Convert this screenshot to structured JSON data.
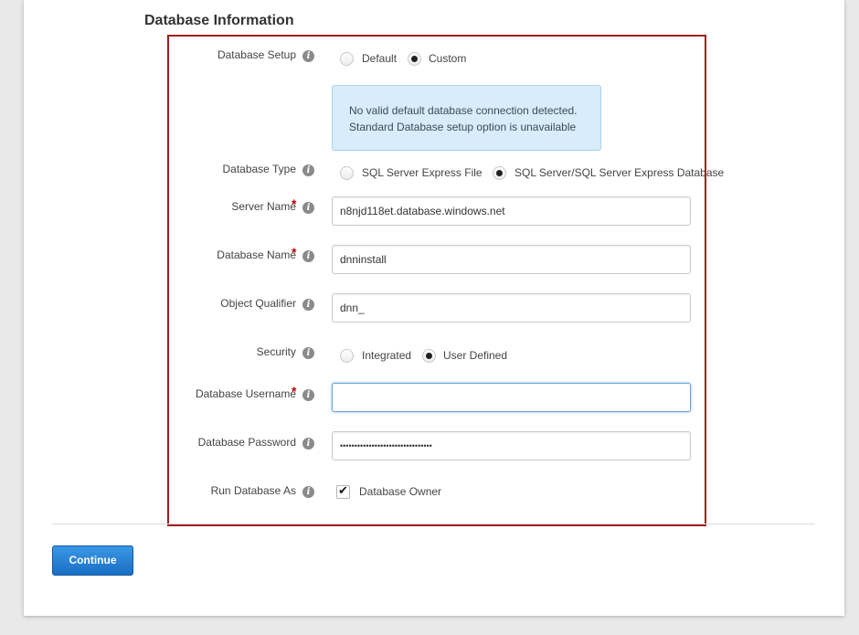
{
  "section": {
    "title": "Database Information"
  },
  "database_setup": {
    "label": "Database Setup",
    "options": [
      {
        "label": "Default",
        "checked": false
      },
      {
        "label": "Custom",
        "checked": true
      }
    ],
    "alert": {
      "line1": "No valid default database connection detected.",
      "line2": "Standard Database setup option is unavailable"
    }
  },
  "database_type": {
    "label": "Database Type",
    "options": [
      {
        "label": "SQL Server Express File",
        "checked": false
      },
      {
        "label": "SQL Server/SQL Server Express Database",
        "checked": true
      }
    ]
  },
  "server_name": {
    "label": "Server Name",
    "required": "*",
    "value": "n8njd118et.database.windows.net"
  },
  "database_name": {
    "label": "Database Name",
    "required": "*",
    "value": "dnninstall"
  },
  "object_qualifier": {
    "label": "Object Qualifier",
    "value": "dnn_"
  },
  "security": {
    "label": "Security",
    "options": [
      {
        "label": "Integrated",
        "checked": false
      },
      {
        "label": "User Defined",
        "checked": true
      }
    ]
  },
  "database_username": {
    "label": "Database Username",
    "required": "*",
    "value": ""
  },
  "database_password": {
    "label": "Database Password",
    "value": "••••••••••••••••••••••••••••••••"
  },
  "run_database_as": {
    "label": "Run Database As",
    "checkbox_label": "Database Owner",
    "checked": true
  },
  "info_icon_glyph": "i",
  "checkmark_glyph": "✔",
  "continue_button": {
    "label": "Continue"
  },
  "colors": {
    "highlight_border": "#a31b1b",
    "required": "#c40000",
    "button": "#1a6fc4",
    "alert_bg": "#d8ecfb"
  }
}
